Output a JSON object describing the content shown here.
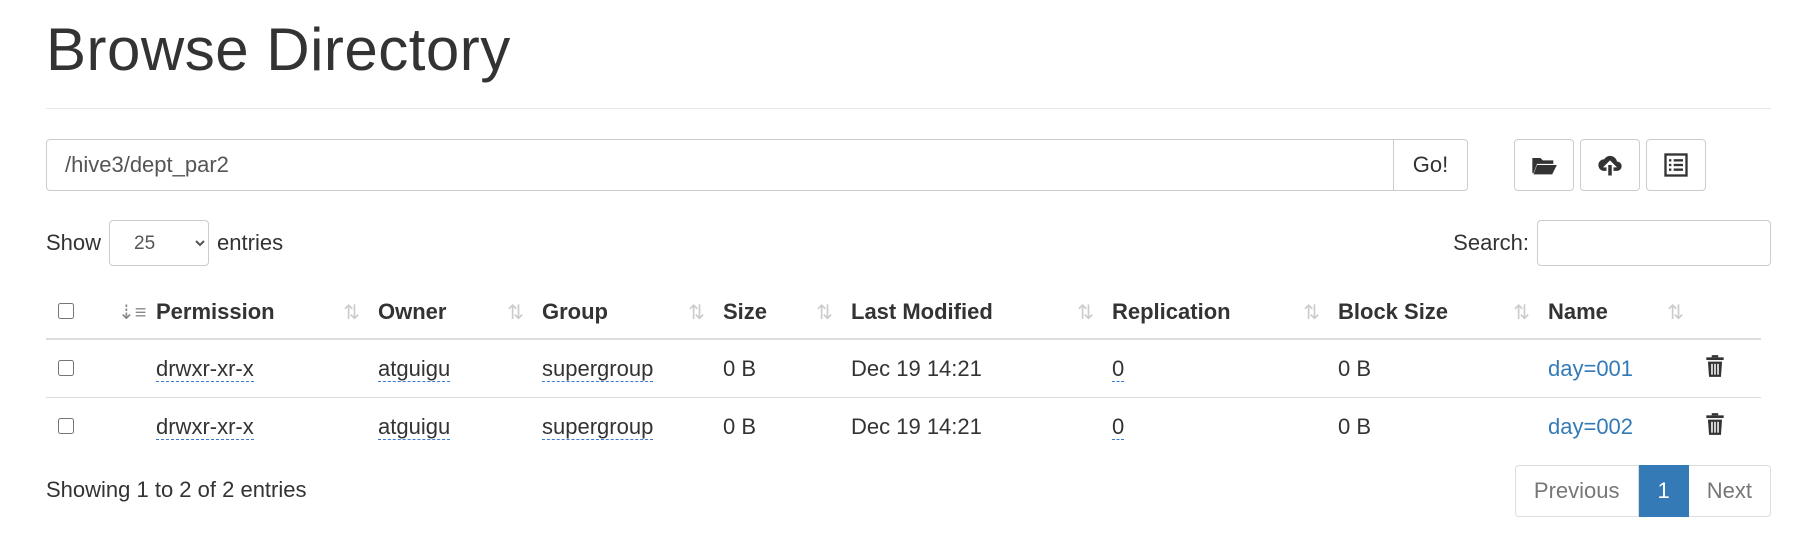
{
  "page": {
    "title": "Browse Directory"
  },
  "pathbar": {
    "path": "/hive3/dept_par2",
    "go_label": "Go!"
  },
  "toolbar": {
    "icons": [
      "folder-open-icon",
      "cloud-upload-icon",
      "list-icon"
    ]
  },
  "length": {
    "show_label": "Show",
    "value": "25",
    "entries_label": "entries"
  },
  "search": {
    "label": "Search:",
    "value": ""
  },
  "table": {
    "columns": [
      "Permission",
      "Owner",
      "Group",
      "Size",
      "Last Modified",
      "Replication",
      "Block Size",
      "Name"
    ],
    "rows": [
      {
        "permission": "drwxr-xr-x",
        "owner": "atguigu",
        "group": "supergroup",
        "size": "0 B",
        "modified": "Dec 19 14:21",
        "replication": "0",
        "block_size": "0 B",
        "name": "day=001"
      },
      {
        "permission": "drwxr-xr-x",
        "owner": "atguigu",
        "group": "supergroup",
        "size": "0 B",
        "modified": "Dec 19 14:21",
        "replication": "0",
        "block_size": "0 B",
        "name": "day=002"
      }
    ]
  },
  "footer": {
    "info": "Showing 1 to 2 of 2 entries",
    "previous": "Previous",
    "current_page": "1",
    "next": "Next"
  },
  "colors": {
    "link": "#337ab7",
    "accent": "#337ab7"
  }
}
